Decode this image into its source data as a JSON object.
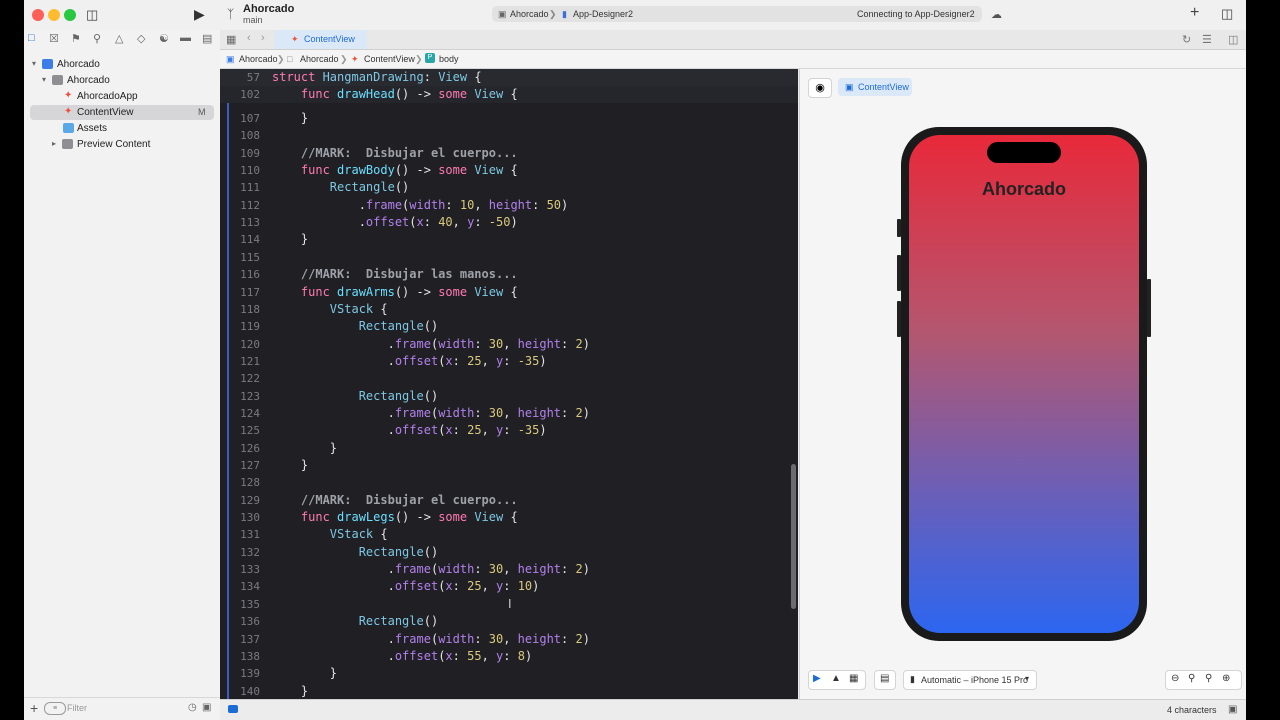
{
  "window": {
    "project_name": "Ahorcado",
    "branch": "main",
    "activity": {
      "scheme": "Ahorcado",
      "destination": "App-Designer2",
      "status": "Connecting to App-Designer2"
    }
  },
  "navigator": {
    "filter_placeholder": "Filter",
    "tree": [
      {
        "label": "Ahorcado",
        "kind": "project"
      },
      {
        "label": "Ahorcado",
        "kind": "folder"
      },
      {
        "label": "AhorcadoApp",
        "kind": "swift"
      },
      {
        "label": "ContentView",
        "kind": "swift",
        "badge": "M",
        "selected": true
      },
      {
        "label": "Assets",
        "kind": "assets"
      },
      {
        "label": "Preview Content",
        "kind": "folder"
      }
    ]
  },
  "editor": {
    "tab": "ContentView",
    "breadcrumb": [
      "Ahorcado",
      "Ahorcado",
      "ContentView",
      "body"
    ],
    "sticky": [
      {
        "ln": "57",
        "tokens": [
          [
            "k",
            "struct "
          ],
          [
            "t",
            "HangmanDrawing"
          ],
          [
            "p",
            ": "
          ],
          [
            "t",
            "View"
          ],
          [
            "p",
            " {"
          ]
        ]
      },
      {
        "ln": "102",
        "tokens": [
          [
            "p",
            "    "
          ],
          [
            "k",
            "func "
          ],
          [
            "d",
            "drawHead"
          ],
          [
            "p",
            "() -> "
          ],
          [
            "k",
            "some "
          ],
          [
            "t",
            "View"
          ],
          [
            "p",
            " {"
          ]
        ]
      }
    ],
    "lines": [
      {
        "ln": "107",
        "tokens": [
          [
            "p",
            "    }"
          ]
        ]
      },
      {
        "ln": "108",
        "tokens": []
      },
      {
        "ln": "109",
        "tokens": [
          [
            "p",
            "    "
          ],
          [
            "c",
            "//MARK:  Disbujar el cuerpo..."
          ]
        ]
      },
      {
        "ln": "110",
        "tokens": [
          [
            "p",
            "    "
          ],
          [
            "k",
            "func "
          ],
          [
            "d",
            "drawBody"
          ],
          [
            "p",
            "() -> "
          ],
          [
            "k",
            "some "
          ],
          [
            "t",
            "View"
          ],
          [
            "p",
            " {"
          ]
        ]
      },
      {
        "ln": "111",
        "tokens": [
          [
            "p",
            "        "
          ],
          [
            "t",
            "Rectangle"
          ],
          [
            "p",
            "()"
          ]
        ]
      },
      {
        "ln": "112",
        "tokens": [
          [
            "p",
            "            ."
          ],
          [
            "f",
            "frame"
          ],
          [
            "p",
            "("
          ],
          [
            "f",
            "width"
          ],
          [
            "p",
            ": "
          ],
          [
            "n",
            "10"
          ],
          [
            "p",
            ", "
          ],
          [
            "f",
            "height"
          ],
          [
            "p",
            ": "
          ],
          [
            "n",
            "50"
          ],
          [
            "p",
            ")"
          ]
        ]
      },
      {
        "ln": "113",
        "tokens": [
          [
            "p",
            "            ."
          ],
          [
            "f",
            "offset"
          ],
          [
            "p",
            "("
          ],
          [
            "f",
            "x"
          ],
          [
            "p",
            ": "
          ],
          [
            "n",
            "40"
          ],
          [
            "p",
            ", "
          ],
          [
            "f",
            "y"
          ],
          [
            "p",
            ": "
          ],
          [
            "n",
            "-50"
          ],
          [
            "p",
            ")"
          ]
        ]
      },
      {
        "ln": "114",
        "tokens": [
          [
            "p",
            "    }"
          ]
        ]
      },
      {
        "ln": "115",
        "tokens": []
      },
      {
        "ln": "116",
        "tokens": [
          [
            "p",
            "    "
          ],
          [
            "c",
            "//MARK:  Disbujar las manos..."
          ]
        ]
      },
      {
        "ln": "117",
        "tokens": [
          [
            "p",
            "    "
          ],
          [
            "k",
            "func "
          ],
          [
            "d",
            "drawArms"
          ],
          [
            "p",
            "() -> "
          ],
          [
            "k",
            "some "
          ],
          [
            "t",
            "View"
          ],
          [
            "p",
            " {"
          ]
        ]
      },
      {
        "ln": "118",
        "tokens": [
          [
            "p",
            "        "
          ],
          [
            "t",
            "VStack"
          ],
          [
            "p",
            " {"
          ]
        ]
      },
      {
        "ln": "119",
        "tokens": [
          [
            "p",
            "            "
          ],
          [
            "t",
            "Rectangle"
          ],
          [
            "p",
            "()"
          ]
        ]
      },
      {
        "ln": "120",
        "tokens": [
          [
            "p",
            "                ."
          ],
          [
            "f",
            "frame"
          ],
          [
            "p",
            "("
          ],
          [
            "f",
            "width"
          ],
          [
            "p",
            ": "
          ],
          [
            "n",
            "30"
          ],
          [
            "p",
            ", "
          ],
          [
            "f",
            "height"
          ],
          [
            "p",
            ": "
          ],
          [
            "n",
            "2"
          ],
          [
            "p",
            ")"
          ]
        ]
      },
      {
        "ln": "121",
        "tokens": [
          [
            "p",
            "                ."
          ],
          [
            "f",
            "offset"
          ],
          [
            "p",
            "("
          ],
          [
            "f",
            "x"
          ],
          [
            "p",
            ": "
          ],
          [
            "n",
            "25"
          ],
          [
            "p",
            ", "
          ],
          [
            "f",
            "y"
          ],
          [
            "p",
            ": "
          ],
          [
            "n",
            "-35"
          ],
          [
            "p",
            ")"
          ]
        ]
      },
      {
        "ln": "122",
        "tokens": []
      },
      {
        "ln": "123",
        "tokens": [
          [
            "p",
            "            "
          ],
          [
            "t",
            "Rectangle"
          ],
          [
            "p",
            "()"
          ]
        ]
      },
      {
        "ln": "124",
        "tokens": [
          [
            "p",
            "                ."
          ],
          [
            "f",
            "frame"
          ],
          [
            "p",
            "("
          ],
          [
            "f",
            "width"
          ],
          [
            "p",
            ": "
          ],
          [
            "n",
            "30"
          ],
          [
            "p",
            ", "
          ],
          [
            "f",
            "height"
          ],
          [
            "p",
            ": "
          ],
          [
            "n",
            "2"
          ],
          [
            "p",
            ")"
          ]
        ]
      },
      {
        "ln": "125",
        "tokens": [
          [
            "p",
            "                ."
          ],
          [
            "f",
            "offset"
          ],
          [
            "p",
            "("
          ],
          [
            "f",
            "x"
          ],
          [
            "p",
            ": "
          ],
          [
            "n",
            "25"
          ],
          [
            "p",
            ", "
          ],
          [
            "f",
            "y"
          ],
          [
            "p",
            ": "
          ],
          [
            "n",
            "-35"
          ],
          [
            "p",
            ")"
          ]
        ]
      },
      {
        "ln": "126",
        "tokens": [
          [
            "p",
            "        }"
          ]
        ]
      },
      {
        "ln": "127",
        "tokens": [
          [
            "p",
            "    }"
          ]
        ]
      },
      {
        "ln": "128",
        "tokens": []
      },
      {
        "ln": "129",
        "tokens": [
          [
            "p",
            "    "
          ],
          [
            "c",
            "//MARK:  Disbujar el cuerpo..."
          ]
        ]
      },
      {
        "ln": "130",
        "tokens": [
          [
            "p",
            "    "
          ],
          [
            "k",
            "func "
          ],
          [
            "d",
            "drawLegs"
          ],
          [
            "p",
            "() -> "
          ],
          [
            "k",
            "some "
          ],
          [
            "t",
            "View"
          ],
          [
            "p",
            " {"
          ]
        ]
      },
      {
        "ln": "131",
        "tokens": [
          [
            "p",
            "        "
          ],
          [
            "t",
            "VStack"
          ],
          [
            "p",
            " {"
          ]
        ]
      },
      {
        "ln": "132",
        "tokens": [
          [
            "p",
            "            "
          ],
          [
            "t",
            "Rectangle"
          ],
          [
            "p",
            "()"
          ]
        ]
      },
      {
        "ln": "133",
        "tokens": [
          [
            "p",
            "                ."
          ],
          [
            "f",
            "frame"
          ],
          [
            "p",
            "("
          ],
          [
            "f",
            "width"
          ],
          [
            "p",
            ": "
          ],
          [
            "n",
            "30"
          ],
          [
            "p",
            ", "
          ],
          [
            "f",
            "height"
          ],
          [
            "p",
            ": "
          ],
          [
            "n",
            "2"
          ],
          [
            "p",
            ")"
          ]
        ]
      },
      {
        "ln": "134",
        "tokens": [
          [
            "p",
            "                ."
          ],
          [
            "f",
            "offset"
          ],
          [
            "p",
            "("
          ],
          [
            "f",
            "x"
          ],
          [
            "p",
            ": "
          ],
          [
            "n",
            "25"
          ],
          [
            "p",
            ", "
          ],
          [
            "f",
            "y"
          ],
          [
            "p",
            ": "
          ],
          [
            "n",
            "10"
          ],
          [
            "p",
            ")"
          ]
        ]
      },
      {
        "ln": "135",
        "tokens": []
      },
      {
        "ln": "136",
        "tokens": [
          [
            "p",
            "            "
          ],
          [
            "t",
            "Rectangle"
          ],
          [
            "p",
            "()"
          ]
        ]
      },
      {
        "ln": "137",
        "tokens": [
          [
            "p",
            "                ."
          ],
          [
            "f",
            "frame"
          ],
          [
            "p",
            "("
          ],
          [
            "f",
            "width"
          ],
          [
            "p",
            ": "
          ],
          [
            "n",
            "30"
          ],
          [
            "p",
            ", "
          ],
          [
            "f",
            "height"
          ],
          [
            "p",
            ": "
          ],
          [
            "n",
            "2"
          ],
          [
            "p",
            ")"
          ]
        ]
      },
      {
        "ln": "138",
        "tokens": [
          [
            "p",
            "                ."
          ],
          [
            "f",
            "offset"
          ],
          [
            "p",
            "("
          ],
          [
            "f",
            "x"
          ],
          [
            "p",
            ": "
          ],
          [
            "n",
            "55"
          ],
          [
            "p",
            ", "
          ],
          [
            "f",
            "y"
          ],
          [
            "p",
            ": "
          ],
          [
            "n",
            "8"
          ],
          [
            "p",
            ")"
          ]
        ]
      },
      {
        "ln": "139",
        "tokens": [
          [
            "p",
            "        }"
          ]
        ]
      },
      {
        "ln": "140",
        "tokens": [
          [
            "p",
            "    }"
          ]
        ]
      }
    ]
  },
  "canvas": {
    "chip": "ContentView",
    "app_title": "Ahorcado",
    "device": "Automatic – iPhone 15 Pro"
  },
  "status": {
    "selection": "4 characters"
  },
  "colors": {
    "keyword": "#ff7ab2",
    "type": "#7ec8e3",
    "param": "#b281eb",
    "number": "#d9c97c",
    "comment": "#9ea1a8",
    "accent": "#1d6cd6"
  }
}
